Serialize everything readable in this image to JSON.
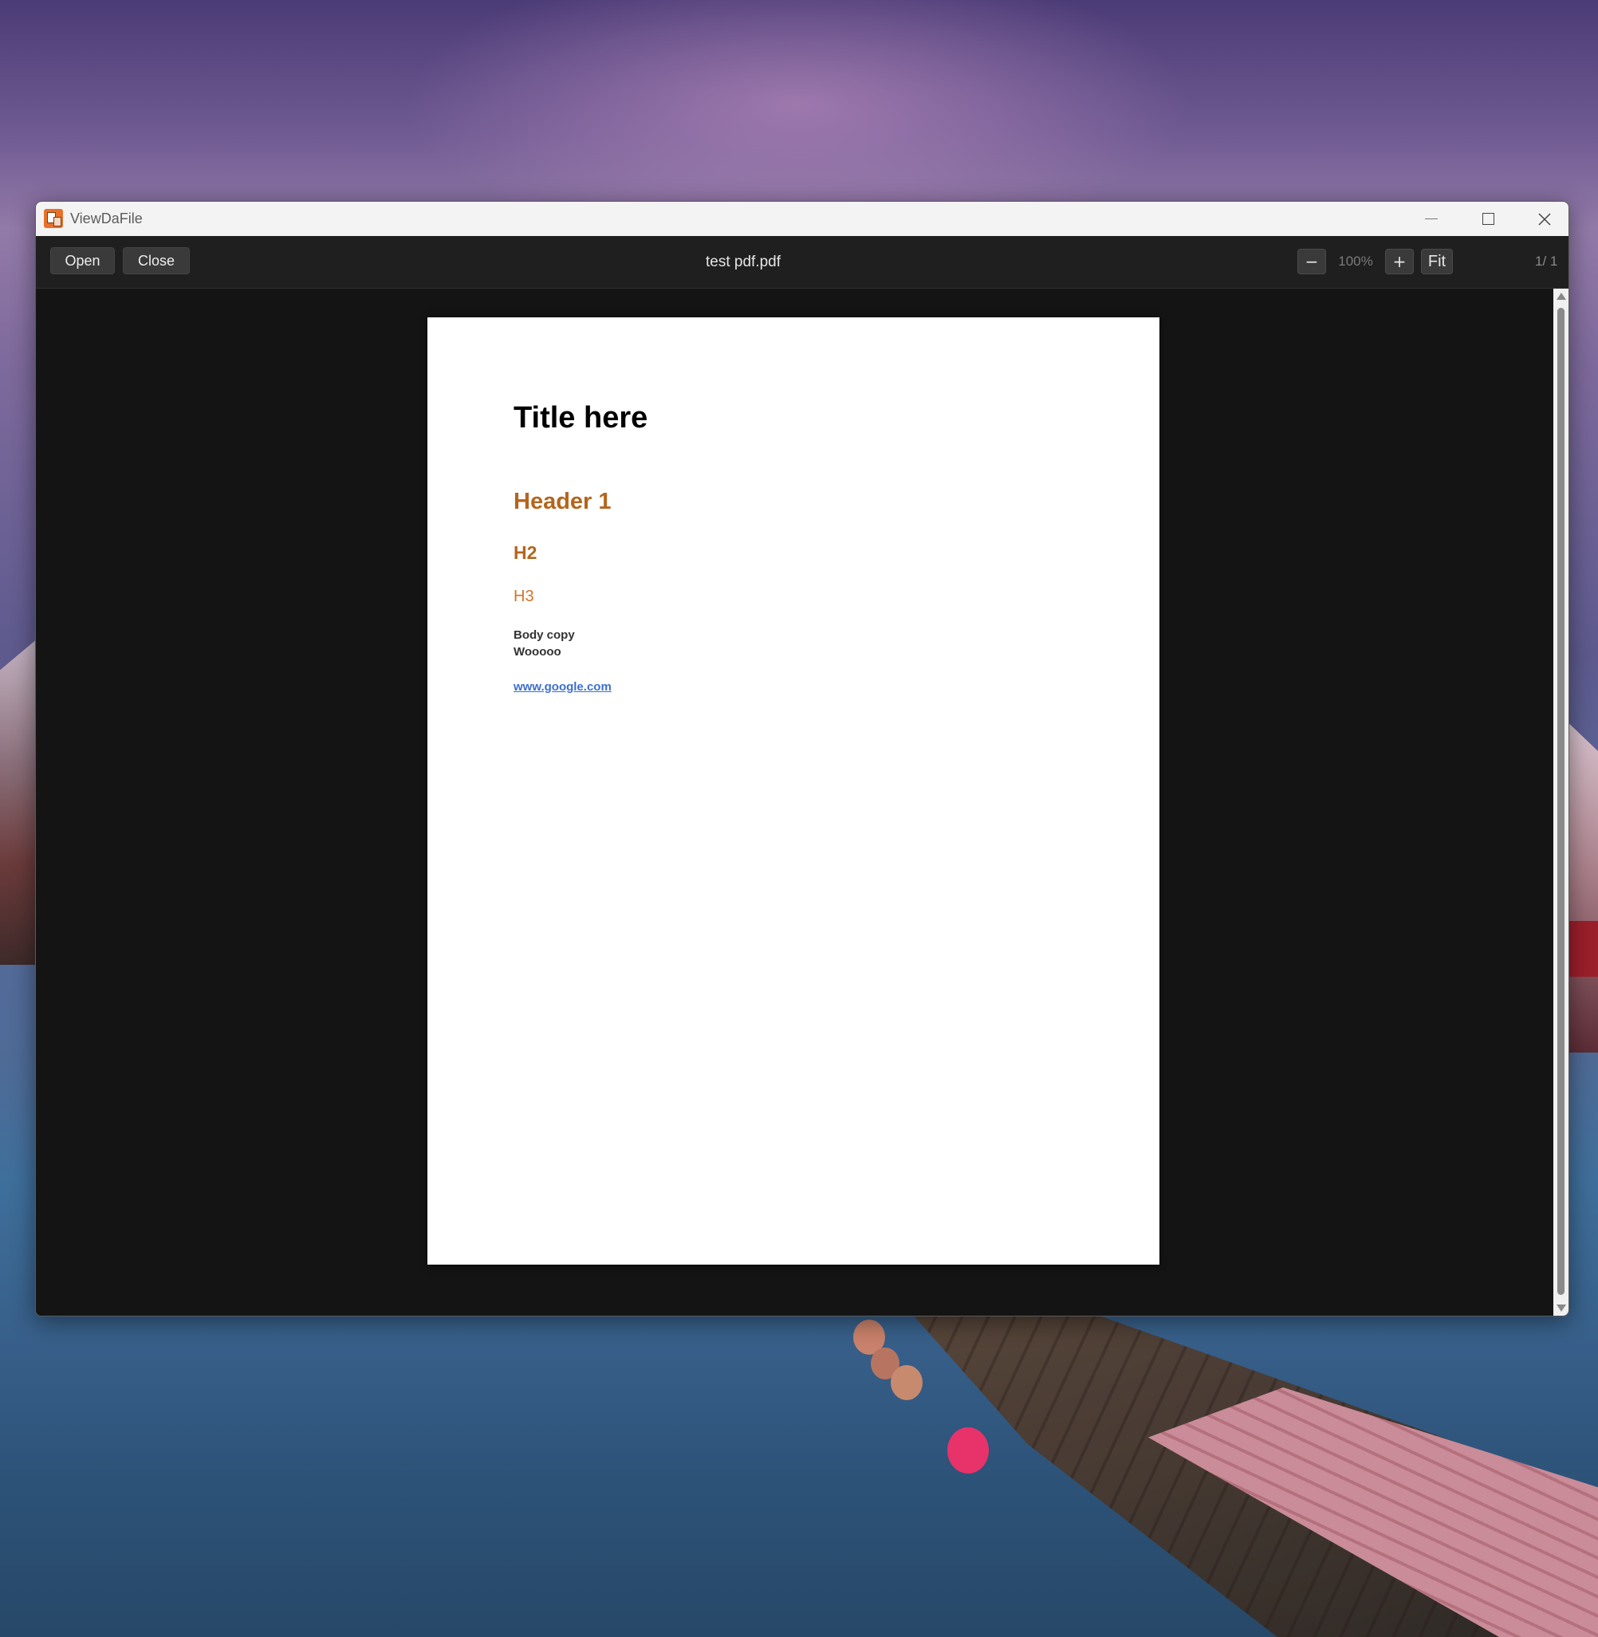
{
  "window": {
    "app_title": "ViewDaFile",
    "controls": {
      "minimize": "minimize",
      "maximize": "maximize",
      "close": "close"
    }
  },
  "toolbar": {
    "open_label": "Open",
    "close_label": "Close",
    "filename": "test pdf.pdf",
    "zoom_out_label": "−",
    "zoom_level": "100%",
    "zoom_in_label": "+",
    "fit_label": "Fit",
    "page_indicator": "1/ 1"
  },
  "document": {
    "title": "Title here",
    "header1": "Header 1",
    "header2": "H2",
    "header3": "H3",
    "body_line1": "Body copy",
    "body_line2": "Wooooo",
    "link_text": "www.google.com"
  },
  "colors": {
    "accent_heading": "#b5651d",
    "link": "#3b6fd0",
    "toolbar_bg": "#1f1f1f",
    "viewport_bg": "#141414"
  },
  "icons": [
    "app-icon",
    "minimize-icon",
    "maximize-icon",
    "close-icon"
  ]
}
